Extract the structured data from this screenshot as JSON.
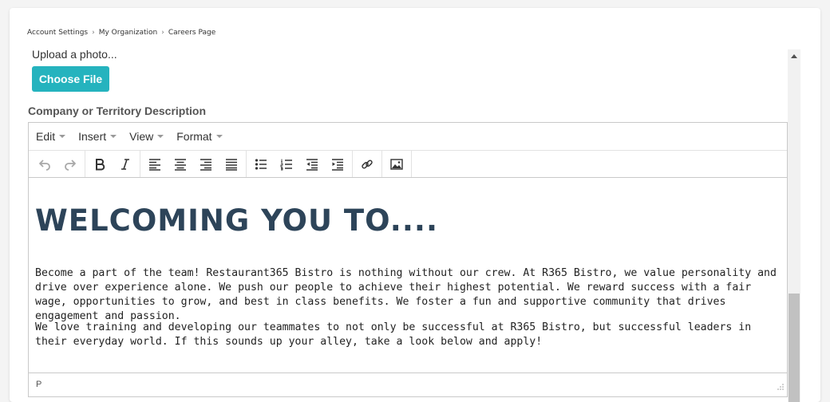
{
  "breadcrumb": {
    "items": [
      "Account Settings",
      "My Organization",
      "Careers Page"
    ],
    "separator": "›"
  },
  "upload": {
    "label": "Upload a photo...",
    "button_label": "Choose File"
  },
  "section": {
    "title": "Company or Territory Description"
  },
  "editor": {
    "menus": [
      "Edit",
      "Insert",
      "View",
      "Format"
    ],
    "toolbar_icons": [
      "undo-icon",
      "redo-icon",
      "bold-icon",
      "italic-icon",
      "align-left-icon",
      "align-center-icon",
      "align-right-icon",
      "align-justify-icon",
      "bullet-list-icon",
      "numbered-list-icon",
      "outdent-icon",
      "indent-icon",
      "link-icon",
      "image-icon"
    ],
    "content": {
      "heading": "WELCOMING YOU TO....",
      "paragraph1": "Become a part of the team! Restaurant365 Bistro is nothing without our crew. At R365 Bistro, we value personality and drive over experience alone. We push our people to achieve their highest potential. We reward success with a fair wage, opportunities to grow, and best in class benefits. We foster a fun and supportive community that drives engagement and passion.",
      "paragraph2": "We love training and developing our teammates to not only be successful at R365 Bistro, but successful leaders in their everyday world. If this sounds up your alley, take a look below and apply!"
    },
    "status_path": "P"
  },
  "colors": {
    "accent": "#25b3be",
    "heading": "#2d4459"
  }
}
